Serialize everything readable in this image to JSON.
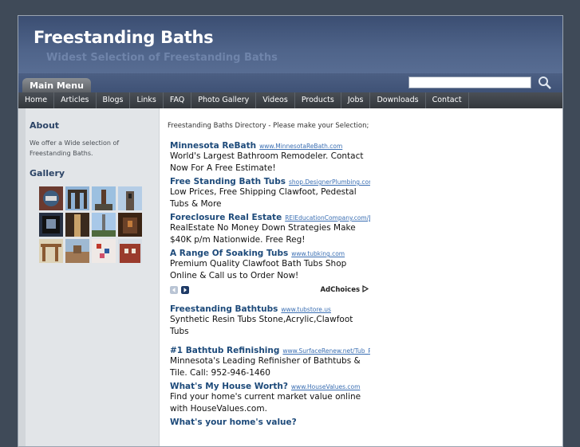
{
  "header": {
    "title": "Freestanding Baths",
    "subtitle": "Widest Selection of Freestanding Baths",
    "main_menu_label": "Main Menu"
  },
  "search": {
    "placeholder": "",
    "value": ""
  },
  "nav": {
    "items": [
      "Home",
      "Articles",
      "Blogs",
      "Links",
      "FAQ",
      "Photo Gallery",
      "Videos",
      "Products",
      "Jobs",
      "Downloads",
      "Contact"
    ]
  },
  "sidebar": {
    "about_heading": "About",
    "about_text": "We offer a Wide selection of Freestanding Baths.",
    "gallery_heading": "Gallery"
  },
  "main": {
    "directory_text": "Freestanding Baths Directory - Please make your Selection;",
    "ads_top": [
      {
        "title": "Minnesota ReBath",
        "url": "www.MinnesotaReBath.com",
        "text": "World's Largest Bathroom Remodeler. Contact Now For A Free Estimate!"
      },
      {
        "title": "Free Standing Bath Tubs",
        "url": "shop.DesignerPlumbing.com",
        "text": "Low Prices, Free Shipping Clawfoot, Pedestal Tubs & More"
      },
      {
        "title": "Foreclosure Real Estate",
        "url": "REIEducationCompany.com/Join-N",
        "text": "RealEstate No Money Down Strategies Make $40K p/m Nationwide. Free Reg!"
      },
      {
        "title": "A Range Of Soaking Tubs",
        "url": "www.tubking.com",
        "text": "Premium Quality Clawfoot Bath Tubs Shop Online & Call us to Order Now!"
      }
    ],
    "adchoices_label": "AdChoices",
    "ads_bottom": [
      {
        "title": "Freestanding Bathtubs",
        "url": "www.tubstore.us",
        "text": "Synthetic Resin Tubs Stone,Acrylic,Clawfoot Tubs"
      },
      {
        "title": "#1 Bathtub Refinishing",
        "url": "www.SurfaceRenew.net/Tub_Refini",
        "text": "Minnesota's Leading Refinisher of Bathtubs & Tile. Call: 952-946-1460"
      },
      {
        "title": "What's My House Worth?",
        "url": "www.HouseValues.com",
        "text": "Find your home's current market value online with HouseValues.com."
      },
      {
        "title": "What's your home's value?",
        "url": "",
        "text": ""
      }
    ]
  },
  "colors": {
    "header_bg": "#4f648a",
    "ad_title": "#1d4a7a",
    "ad_url": "#3b6fb3",
    "sidebar_heading": "#2c4466"
  },
  "icons": {
    "search": "search-icon",
    "prev": "chevron-left-icon",
    "next": "chevron-right-icon",
    "adchoices": "adchoices-triangle-icon"
  }
}
